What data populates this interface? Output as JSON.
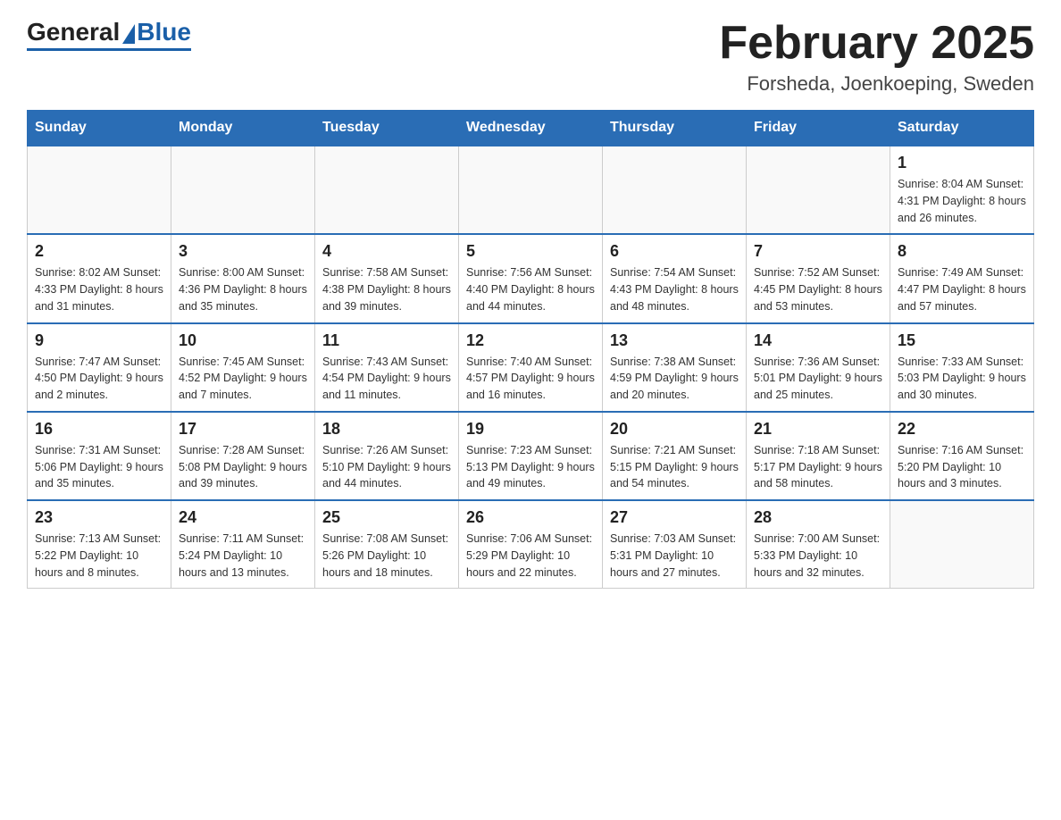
{
  "logo": {
    "general": "General",
    "blue": "Blue"
  },
  "header": {
    "month": "February 2025",
    "location": "Forsheda, Joenkoeping, Sweden"
  },
  "weekdays": [
    "Sunday",
    "Monday",
    "Tuesday",
    "Wednesday",
    "Thursday",
    "Friday",
    "Saturday"
  ],
  "weeks": [
    [
      {
        "day": "",
        "info": ""
      },
      {
        "day": "",
        "info": ""
      },
      {
        "day": "",
        "info": ""
      },
      {
        "day": "",
        "info": ""
      },
      {
        "day": "",
        "info": ""
      },
      {
        "day": "",
        "info": ""
      },
      {
        "day": "1",
        "info": "Sunrise: 8:04 AM\nSunset: 4:31 PM\nDaylight: 8 hours and 26 minutes."
      }
    ],
    [
      {
        "day": "2",
        "info": "Sunrise: 8:02 AM\nSunset: 4:33 PM\nDaylight: 8 hours and 31 minutes."
      },
      {
        "day": "3",
        "info": "Sunrise: 8:00 AM\nSunset: 4:36 PM\nDaylight: 8 hours and 35 minutes."
      },
      {
        "day": "4",
        "info": "Sunrise: 7:58 AM\nSunset: 4:38 PM\nDaylight: 8 hours and 39 minutes."
      },
      {
        "day": "5",
        "info": "Sunrise: 7:56 AM\nSunset: 4:40 PM\nDaylight: 8 hours and 44 minutes."
      },
      {
        "day": "6",
        "info": "Sunrise: 7:54 AM\nSunset: 4:43 PM\nDaylight: 8 hours and 48 minutes."
      },
      {
        "day": "7",
        "info": "Sunrise: 7:52 AM\nSunset: 4:45 PM\nDaylight: 8 hours and 53 minutes."
      },
      {
        "day": "8",
        "info": "Sunrise: 7:49 AM\nSunset: 4:47 PM\nDaylight: 8 hours and 57 minutes."
      }
    ],
    [
      {
        "day": "9",
        "info": "Sunrise: 7:47 AM\nSunset: 4:50 PM\nDaylight: 9 hours and 2 minutes."
      },
      {
        "day": "10",
        "info": "Sunrise: 7:45 AM\nSunset: 4:52 PM\nDaylight: 9 hours and 7 minutes."
      },
      {
        "day": "11",
        "info": "Sunrise: 7:43 AM\nSunset: 4:54 PM\nDaylight: 9 hours and 11 minutes."
      },
      {
        "day": "12",
        "info": "Sunrise: 7:40 AM\nSunset: 4:57 PM\nDaylight: 9 hours and 16 minutes."
      },
      {
        "day": "13",
        "info": "Sunrise: 7:38 AM\nSunset: 4:59 PM\nDaylight: 9 hours and 20 minutes."
      },
      {
        "day": "14",
        "info": "Sunrise: 7:36 AM\nSunset: 5:01 PM\nDaylight: 9 hours and 25 minutes."
      },
      {
        "day": "15",
        "info": "Sunrise: 7:33 AM\nSunset: 5:03 PM\nDaylight: 9 hours and 30 minutes."
      }
    ],
    [
      {
        "day": "16",
        "info": "Sunrise: 7:31 AM\nSunset: 5:06 PM\nDaylight: 9 hours and 35 minutes."
      },
      {
        "day": "17",
        "info": "Sunrise: 7:28 AM\nSunset: 5:08 PM\nDaylight: 9 hours and 39 minutes."
      },
      {
        "day": "18",
        "info": "Sunrise: 7:26 AM\nSunset: 5:10 PM\nDaylight: 9 hours and 44 minutes."
      },
      {
        "day": "19",
        "info": "Sunrise: 7:23 AM\nSunset: 5:13 PM\nDaylight: 9 hours and 49 minutes."
      },
      {
        "day": "20",
        "info": "Sunrise: 7:21 AM\nSunset: 5:15 PM\nDaylight: 9 hours and 54 minutes."
      },
      {
        "day": "21",
        "info": "Sunrise: 7:18 AM\nSunset: 5:17 PM\nDaylight: 9 hours and 58 minutes."
      },
      {
        "day": "22",
        "info": "Sunrise: 7:16 AM\nSunset: 5:20 PM\nDaylight: 10 hours and 3 minutes."
      }
    ],
    [
      {
        "day": "23",
        "info": "Sunrise: 7:13 AM\nSunset: 5:22 PM\nDaylight: 10 hours and 8 minutes."
      },
      {
        "day": "24",
        "info": "Sunrise: 7:11 AM\nSunset: 5:24 PM\nDaylight: 10 hours and 13 minutes."
      },
      {
        "day": "25",
        "info": "Sunrise: 7:08 AM\nSunset: 5:26 PM\nDaylight: 10 hours and 18 minutes."
      },
      {
        "day": "26",
        "info": "Sunrise: 7:06 AM\nSunset: 5:29 PM\nDaylight: 10 hours and 22 minutes."
      },
      {
        "day": "27",
        "info": "Sunrise: 7:03 AM\nSunset: 5:31 PM\nDaylight: 10 hours and 27 minutes."
      },
      {
        "day": "28",
        "info": "Sunrise: 7:00 AM\nSunset: 5:33 PM\nDaylight: 10 hours and 32 minutes."
      },
      {
        "day": "",
        "info": ""
      }
    ]
  ]
}
